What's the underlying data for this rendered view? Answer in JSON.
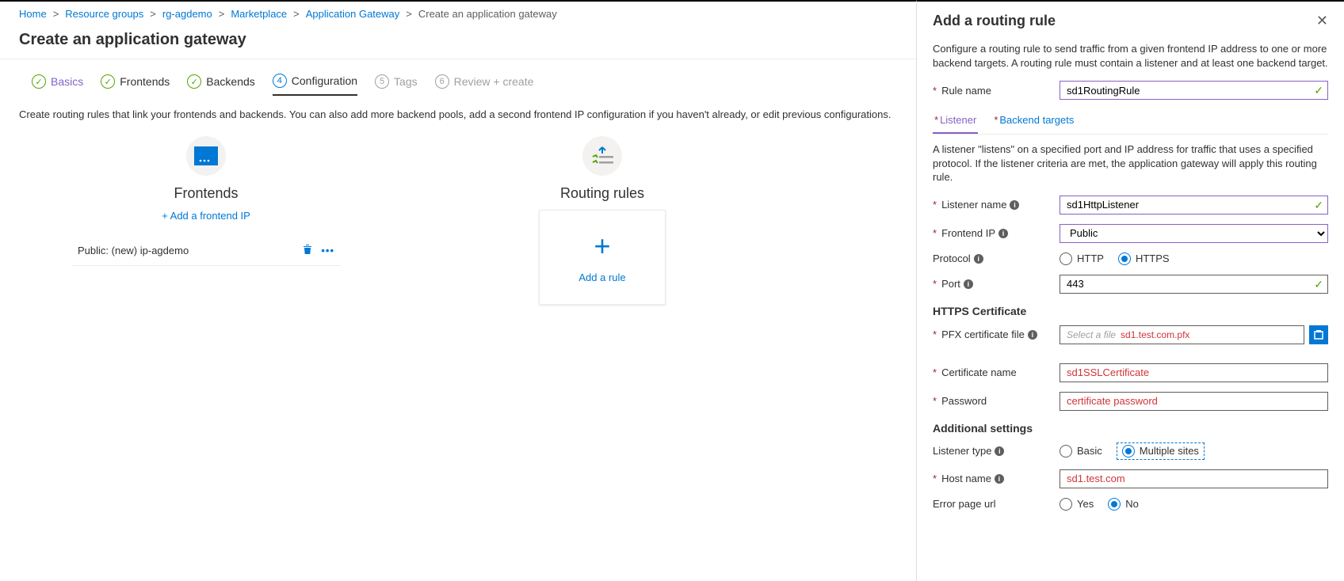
{
  "breadcrumb": {
    "items": [
      "Home",
      "Resource groups",
      "rg-agdemo",
      "Marketplace",
      "Application Gateway"
    ],
    "current": "Create an application gateway"
  },
  "page": {
    "title": "Create an application gateway"
  },
  "steps": [
    {
      "label": "Basics",
      "state": "done"
    },
    {
      "label": "Frontends",
      "state": "done"
    },
    {
      "label": "Backends",
      "state": "done"
    },
    {
      "num": "4",
      "label": "Configuration",
      "state": "current"
    },
    {
      "num": "5",
      "label": "Tags",
      "state": "pending"
    },
    {
      "num": "6",
      "label": "Review + create",
      "state": "pending"
    }
  ],
  "desc": "Create routing rules that link your frontends and backends. You can also add more backend pools, add a second frontend IP configuration if you haven't already, or edit previous configurations.",
  "frontends": {
    "title": "Frontends",
    "addLink": "+ Add a frontend IP",
    "items": [
      {
        "label": "Public: (new) ip-agdemo"
      }
    ]
  },
  "rules": {
    "title": "Routing rules",
    "addLabel": "Add a rule"
  },
  "panel": {
    "title": "Add a routing rule",
    "desc": "Configure a routing rule to send traffic from a given frontend IP address to one or more backend targets. A routing rule must contain a listener and at least one backend target.",
    "ruleName": {
      "label": "Rule name",
      "value": "sd1RoutingRule"
    },
    "tabs": {
      "listener": "Listener",
      "backend": "Backend targets"
    },
    "listenerDesc": "A listener \"listens\" on a specified port and IP address for traffic that uses a specified protocol. If the listener criteria are met, the application gateway will apply this routing rule.",
    "listenerName": {
      "label": "Listener name",
      "value": "sd1HttpListener"
    },
    "frontendIP": {
      "label": "Frontend IP",
      "value": "Public"
    },
    "protocol": {
      "label": "Protocol",
      "http": "HTTP",
      "https": "HTTPS"
    },
    "port": {
      "label": "Port",
      "value": "443"
    },
    "httpsCert": {
      "heading": "HTTPS Certificate"
    },
    "pfx": {
      "label": "PFX certificate file",
      "placeholder": "Select a file",
      "filename": "sd1.test.com.pfx"
    },
    "certName": {
      "label": "Certificate name",
      "value": "sd1SSLCertificate"
    },
    "password": {
      "label": "Password",
      "value": "certificate password"
    },
    "additional": {
      "heading": "Additional settings"
    },
    "listenerType": {
      "label": "Listener type",
      "basic": "Basic",
      "multi": "Multiple sites"
    },
    "hostName": {
      "label": "Host name",
      "value": "sd1.test.com"
    },
    "errorPage": {
      "label": "Error page url",
      "yes": "Yes",
      "no": "No"
    }
  }
}
